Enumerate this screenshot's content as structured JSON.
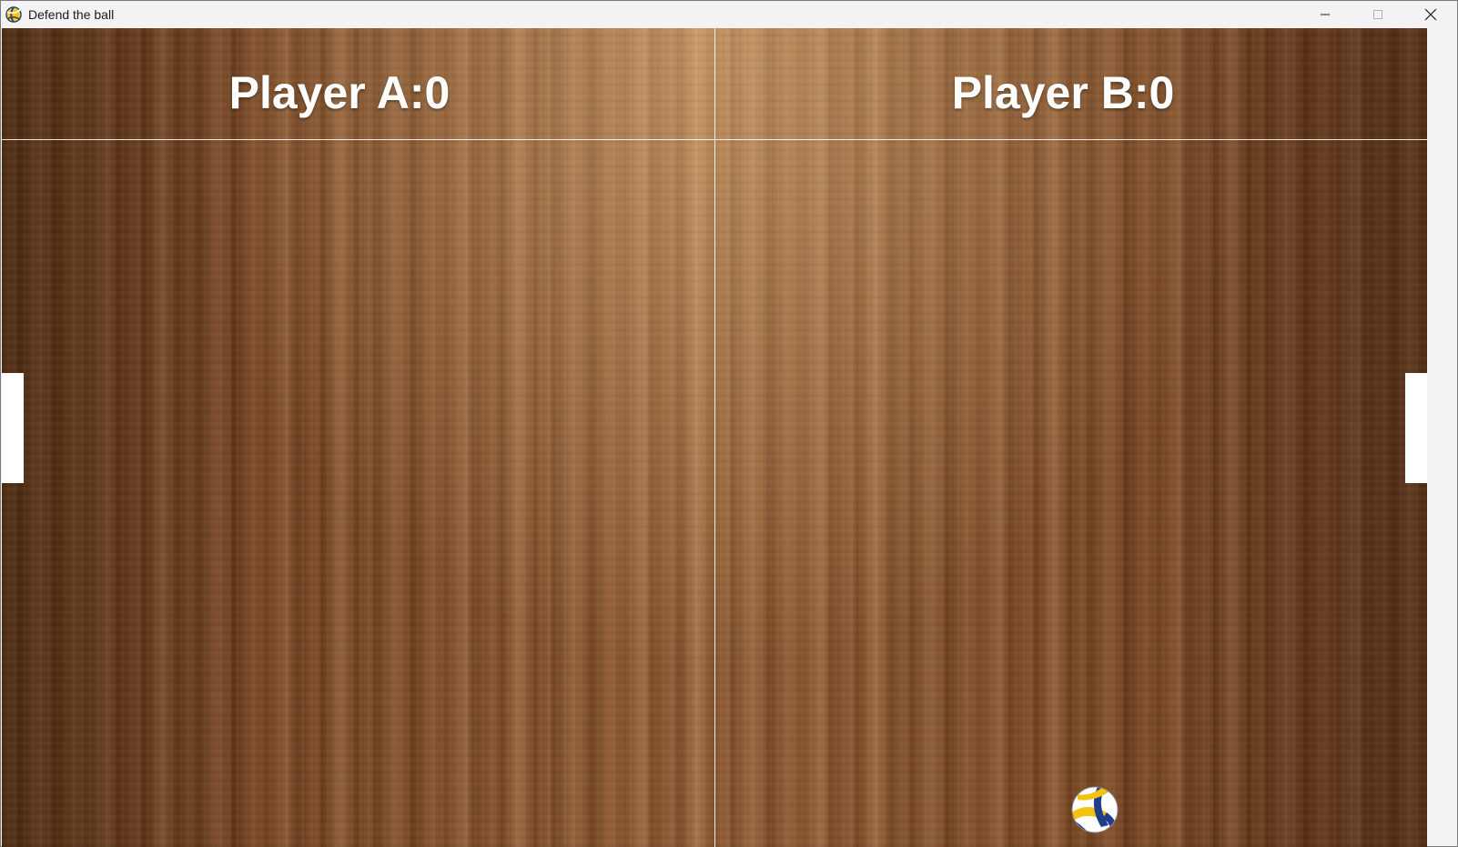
{
  "window": {
    "title": "Defend the ball",
    "controls": [
      "minimize",
      "maximize",
      "close"
    ]
  },
  "icons": {
    "app": "volleyball-icon",
    "minimize": "minimize-icon",
    "maximize": "maximize-icon",
    "close": "close-icon",
    "ball": "volleyball"
  },
  "game": {
    "player_a": {
      "score_text": "Player A:0",
      "score": 0
    },
    "player_b": {
      "score_text": "Player B:0",
      "score": 0
    },
    "colors": {
      "lines": "#ffffff",
      "paddles": "#ffffff",
      "score_text": "#ffffff",
      "floor": "#7a4a24"
    }
  }
}
